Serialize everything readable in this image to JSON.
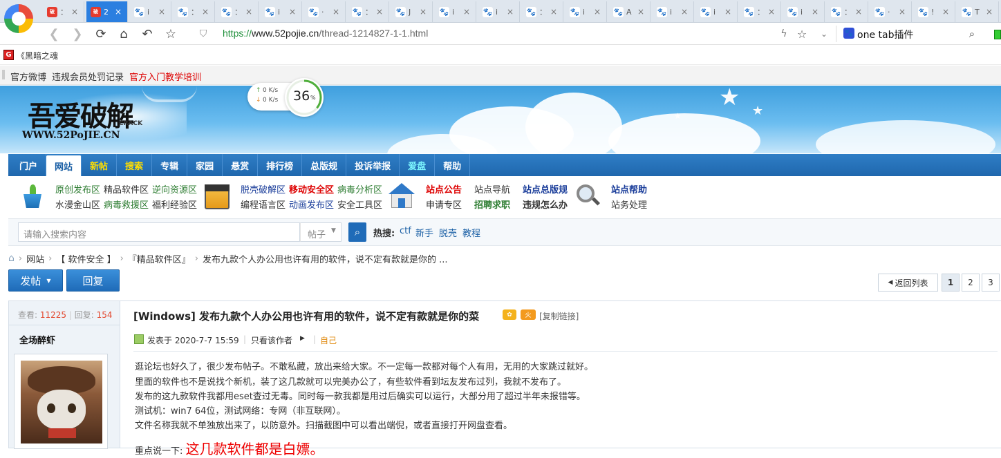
{
  "browser": {
    "tabs": [
      {
        "fav": "破",
        "red": true,
        "text": "："
      },
      {
        "fav": "破",
        "red": true,
        "text": "2"
      },
      {
        "fav": "🐾",
        "red": false,
        "text": "i"
      },
      {
        "fav": "🐾",
        "red": false,
        "text": "："
      },
      {
        "fav": "🐾",
        "red": false,
        "text": "："
      },
      {
        "fav": "🐾",
        "red": false,
        "text": "i"
      },
      {
        "fav": "🐾",
        "red": false,
        "text": "·"
      },
      {
        "fav": "🐾",
        "red": false,
        "text": "："
      },
      {
        "fav": "🐾",
        "red": false,
        "text": "J"
      },
      {
        "fav": "🐾",
        "red": false,
        "text": "i"
      },
      {
        "fav": "🐾",
        "red": false,
        "text": "i"
      },
      {
        "fav": "🐾",
        "red": false,
        "text": "："
      },
      {
        "fav": "🐾",
        "red": false,
        "text": "i"
      },
      {
        "fav": "🐾",
        "red": false,
        "text": "A"
      },
      {
        "fav": "🐾",
        "red": false,
        "text": "i"
      },
      {
        "fav": "🐾",
        "red": false,
        "text": "i"
      },
      {
        "fav": "🐾",
        "red": false,
        "text": "："
      },
      {
        "fav": "🐾",
        "red": false,
        "text": "i"
      },
      {
        "fav": "🐾",
        "red": false,
        "text": "："
      },
      {
        "fav": "🐾",
        "red": false,
        "text": "·"
      },
      {
        "fav": "🐾",
        "red": false,
        "text": "!"
      },
      {
        "fav": "🐾",
        "red": false,
        "text": "T"
      }
    ],
    "close_glyph": "×",
    "url_proto": "https://",
    "url_host": "www.52pojie.cn",
    "url_path": "/thread-1214827-1-1.html",
    "extension_label": "one tab插件",
    "bookmark_label": "《黑暗之魂",
    "accent": "#2b7fe0"
  },
  "subnav": {
    "links": [
      {
        "label": "官方微博",
        "color": "#333"
      },
      {
        "label": "违规会员处罚记录",
        "color": "#333"
      },
      {
        "label": "官方入门教学培训",
        "color": "#d00"
      }
    ]
  },
  "speed": {
    "up": "0  K/s",
    "down": "0  K/s",
    "percent": "36",
    "unit": "%"
  },
  "logo": {
    "main": "吾爱破解",
    "sub": "WWW.52PoJIE.CN",
    "crack": "CRACK"
  },
  "mainnav": [
    {
      "label": "门户",
      "style": ""
    },
    {
      "label": "网站",
      "style": "active"
    },
    {
      "label": "新帖",
      "style": "yellow"
    },
    {
      "label": "搜索",
      "style": "yellow"
    },
    {
      "label": "专辑",
      "style": ""
    },
    {
      "label": "家园",
      "style": ""
    },
    {
      "label": "悬赏",
      "style": ""
    },
    {
      "label": "排行榜",
      "style": ""
    },
    {
      "label": "总版规",
      "style": ""
    },
    {
      "label": "投诉举报",
      "style": ""
    },
    {
      "label": "爱盘",
      "style": "cyan"
    },
    {
      "label": "帮助",
      "style": ""
    }
  ],
  "categories": {
    "group1": [
      "原创发布区",
      "精品软件区",
      "逆向资源区",
      "水漫金山区",
      "病毒救援区",
      "福利经验区"
    ],
    "group2": [
      "脱壳破解区",
      "移动安全区",
      "病毒分析区",
      "编程语言区",
      "动画发布区",
      "安全工具区"
    ],
    "group3": [
      "站点公告",
      "站点导航",
      "站点总版规",
      "申请专区",
      "招聘求职",
      "违规怎么办"
    ],
    "group4": [
      "站点帮助",
      "站务处理"
    ]
  },
  "search": {
    "placeholder": "请输入搜索内容",
    "type": "帖子",
    "hot_label": "热搜:",
    "hot": [
      "ctf",
      "新手",
      "脱壳",
      "教程"
    ]
  },
  "breadcrumb": {
    "items": [
      "网站",
      "【 软件安全 】",
      "『精品软件区』",
      "发布九款个人办公用也许有用的软件，说不定有款就是你的 ..."
    ],
    "sep": "›"
  },
  "actions": {
    "post": "发帖",
    "reply": "回复",
    "back": "返回列表",
    "pages": [
      "1",
      "2",
      "3"
    ]
  },
  "thread": {
    "views_label": "查看:",
    "views": "11225",
    "replies_label": "回复:",
    "replies": "154",
    "author": "全场醉虾",
    "title": "[Windows] 发布九款个人办公用也许有用的软件，说不定有款就是你的菜",
    "copy_link": "[复制链接]",
    "posted_label": "发表于 2020-7-7 15:59",
    "only_author": "只看该作者",
    "floor": "自己",
    "body": [
      "逛论坛也好久了，很少发布帖子。不敢私藏，放出来给大家。不一定每一款都对每个人有用，无用的大家跳过就好。",
      "里面的软件也不是说找个新机，装了这几款就可以完美办公了，有些软件看到坛友发布过列，我就不发布了。",
      "发布的这九款软件我都用eset查过无毒。同时每一款我都是用过后确实可以运行，大部分用了超过半年未报错等。",
      "测试机：win7 64位，测试网络：专网（非互联网）。",
      "文件名称我就不单独放出来了，以防意外。扫描截图中可以看出端倪，或者直接打开网盘查看。"
    ],
    "emphasis_prefix": "重点说一下:",
    "emphasis": "这几款软件都是白嫖。"
  }
}
